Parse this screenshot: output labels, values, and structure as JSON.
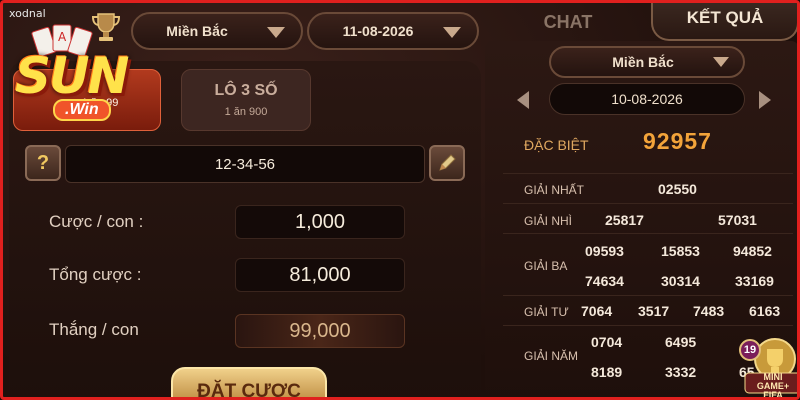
{
  "watermark": "xodnal",
  "logo": {
    "text": "SUN",
    "sub": ".Win"
  },
  "header": {
    "region_select": "Miền Bắc",
    "date_select": "11-08-2026",
    "tabs": [
      {
        "label": "CHAT",
        "active": false
      },
      {
        "label": "KẾT QUẢ",
        "active": true
      }
    ]
  },
  "bet_types": [
    {
      "label": "",
      "odds": "1 ăn 99",
      "active": true
    },
    {
      "label": "LÔ 3 SỐ",
      "odds": "1 ăn 900",
      "active": false
    }
  ],
  "bet_form": {
    "help_label": "?",
    "numbers": "12-34-56",
    "rows": [
      {
        "label": "Cược / con :",
        "value": "1,000"
      },
      {
        "label": "Tổng cược :",
        "value": "81,000"
      },
      {
        "label": "Thắng / con",
        "value": "99,000"
      }
    ],
    "submit_label": "ĐẶT CƯỢC"
  },
  "results": {
    "region": "Miền Bắc",
    "date": "10-08-2026",
    "special": {
      "label": "ĐẶC BIỆT",
      "value": "92957"
    },
    "first": {
      "label": "GIẢI NHẤT",
      "values": [
        "02550"
      ]
    },
    "second": {
      "label": "GIẢI NHÌ",
      "values": [
        "25817",
        "57031"
      ]
    },
    "third": {
      "label": "GIẢI BA",
      "values": [
        "09593",
        "15853",
        "94852",
        "74634",
        "30314",
        "33169"
      ]
    },
    "fourth": {
      "label": "GIẢI TƯ",
      "values": [
        "7064",
        "3517",
        "7483",
        "6163"
      ]
    },
    "fifth": {
      "label": "GIẢI NĂM",
      "values": [
        "0704",
        "6495",
        "8189",
        "3332",
        "65"
      ]
    }
  },
  "mini_game": {
    "badge": "19",
    "label": "MINI GAME+",
    "sub": "FIFA"
  },
  "colors": {
    "accent_gold": "#f3a43a",
    "active_tab_red": "#b23a1e",
    "frame_red": "#e0201e"
  }
}
